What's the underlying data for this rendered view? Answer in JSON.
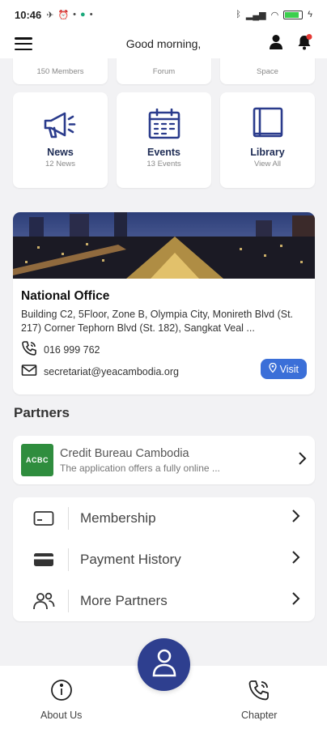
{
  "status_bar": {
    "time": "10:46"
  },
  "app_bar": {
    "greeting": "Good morning,"
  },
  "top_row": [
    {
      "sub": "150 Members"
    },
    {
      "sub": "Forum"
    },
    {
      "sub": "Space"
    }
  ],
  "tiles": [
    {
      "label": "News",
      "sub": "12 News",
      "icon": "megaphone-icon"
    },
    {
      "label": "Events",
      "sub": "13 Events",
      "icon": "calendar-icon"
    },
    {
      "label": "Library",
      "sub": "View All",
      "icon": "book-icon"
    }
  ],
  "office": {
    "title": "National Office",
    "address": "Building C2, 5Floor, Zone B, Olympia City, Monireth Blvd (St. 217) Corner Tephorn Blvd (St. 182), Sangkat Veal ...",
    "phone": "016 999 762",
    "email": "secretariat@yeacambodia.org",
    "visit_label": "Visit"
  },
  "partners": {
    "title": "Partners",
    "items": [
      {
        "logo_text": "ACBC",
        "name": "Credit Bureau Cambodia",
        "desc": "The application offers a fully online ..."
      }
    ]
  },
  "menu": [
    {
      "label": "Membership",
      "icon": "card-icon"
    },
    {
      "label": "Payment History",
      "icon": "payment-card-icon"
    },
    {
      "label": "More Partners",
      "icon": "people-icon"
    }
  ],
  "bottom_nav": {
    "about": "About Us",
    "chapter": "Chapter"
  },
  "colors": {
    "brand": "#2e3f8f",
    "tile_text": "#1e2c55",
    "visit": "#3b6fd8",
    "partner_logo": "#2f8d3e"
  }
}
